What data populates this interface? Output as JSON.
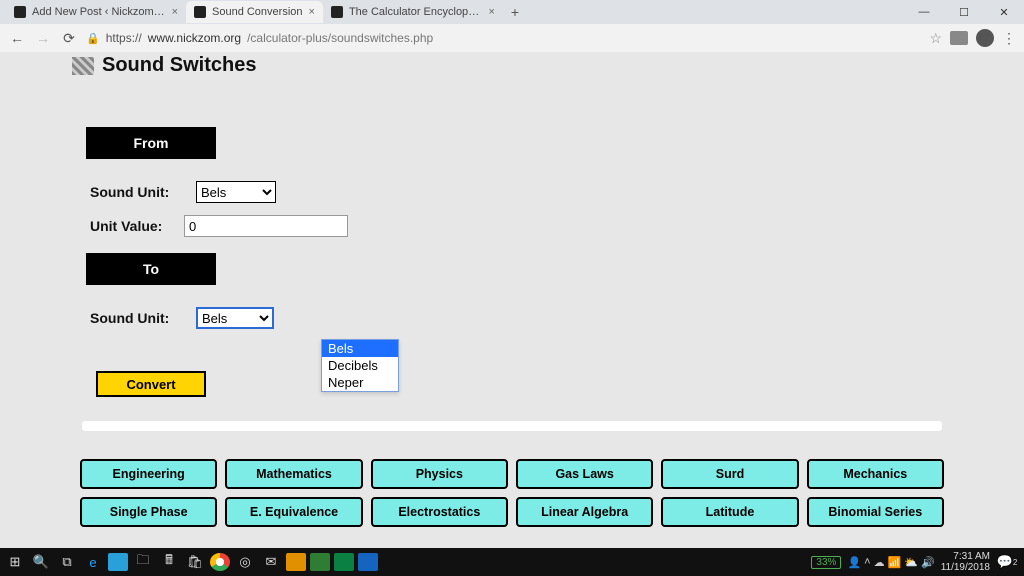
{
  "tabs": [
    {
      "label": "Add New Post ‹ Nickzom Blog —",
      "active": false
    },
    {
      "label": "Sound Conversion",
      "active": true
    },
    {
      "label": "The Calculator Encyclopedia Con",
      "active": false
    }
  ],
  "url_full": "https://www.nickzom.org/calculator-plus/soundswitches.php",
  "url_path": "/calculator-plus/soundswitches.php",
  "url_host": "www.nickzom.org",
  "page": {
    "title": "Sound Switches",
    "from_label": "From",
    "to_label": "To",
    "sound_unit_label": "Sound Unit:",
    "unit_value_label": "Unit Value:",
    "from_selected": "Bels",
    "to_selected": "Bels",
    "unit_value": "0",
    "convert_label": "Convert",
    "unit_options": [
      "Bels",
      "Decibels",
      "Neper"
    ]
  },
  "categories_row1": [
    "Engineering",
    "Mathematics",
    "Physics",
    "Gas Laws",
    "Surd",
    "Mechanics"
  ],
  "categories_row2": [
    "Single Phase",
    "E. Equivalence",
    "Electrostatics",
    "Linear Algebra",
    "Latitude",
    "Binomial Series"
  ],
  "os": {
    "battery": "33%",
    "time": "7:31 AM",
    "date": "11/19/2018",
    "notif": "2"
  }
}
